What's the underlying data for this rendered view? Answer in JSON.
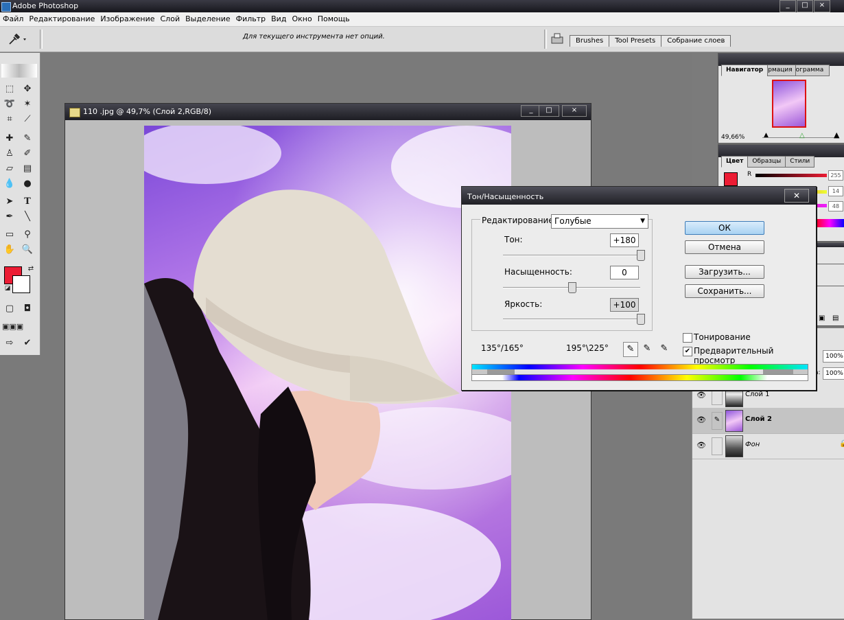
{
  "app": {
    "title": "Adobe Photoshop",
    "window_buttons": [
      "_",
      "□",
      "×"
    ]
  },
  "menu": [
    "Файл",
    "Редактирование",
    "Изображение",
    "Слой",
    "Выделение",
    "Фильтр",
    "Вид",
    "Окно",
    "Помощь"
  ],
  "options_bar": {
    "hint": "Для текущего инструмента нет опций.",
    "palette_well_tabs": [
      "Brushes",
      "Tool Presets",
      "Собрание слоев"
    ]
  },
  "toolbox": {
    "foreground_color": "#ec1c34",
    "background_color": "#ffffff",
    "tools": [
      "marquee-icon",
      "move-icon",
      "lasso-icon",
      "magic-wand-icon",
      "crop-icon",
      "slice-icon",
      "healing-icon",
      "brush-icon",
      "stamp-icon",
      "history-brush-icon",
      "eraser-icon",
      "gradient-icon",
      "blur-icon",
      "dodge-icon",
      "path-select-icon",
      "type-icon",
      "pen-icon",
      "line-icon",
      "notes-icon",
      "eyedropper-icon",
      "hand-icon",
      "zoom-icon"
    ]
  },
  "document": {
    "title": "110 .jpg @ 49,7% (Слой 2,RGB/8)",
    "buttons": [
      "_",
      "□",
      "×"
    ]
  },
  "navigator": {
    "tabs": [
      "Навигатор",
      "Информация",
      "Гистограмма"
    ],
    "visible_tab_labels": [
      "Навигатор",
      "рмация",
      "ограмма"
    ],
    "zoom": "49,66%"
  },
  "color_panel": {
    "tabs": [
      "Цвет",
      "Образцы",
      "Стили"
    ],
    "channel_label_r": "R",
    "values": [
      "255",
      "14",
      "48"
    ]
  },
  "layers": {
    "opacity_value": "100%",
    "fill_value": "100%",
    "fill_label_partial": "а:",
    "rows": [
      {
        "name": "Слой 1",
        "visible": true,
        "active": false
      },
      {
        "name": "Слой 2",
        "visible": true,
        "active": true
      },
      {
        "name": "Фон",
        "visible": true,
        "active": false
      }
    ]
  },
  "dialog": {
    "title": "Тон/Насыщенность",
    "close": "✕",
    "edit_label": "Редактирование:",
    "edit_value": "Голубые",
    "hue_label": "Тон:",
    "hue_value": "+180",
    "sat_label": "Насыщенность:",
    "sat_value": "0",
    "light_label": "Яркость:",
    "light_value": "+100",
    "hue_level": 1.0,
    "sat_level": 0.5,
    "light_level": 1.0,
    "range_left": "135°/165°",
    "range_right": "195°\\225°",
    "ok": "ОК",
    "cancel": "Отмена",
    "load": "Загрузить...",
    "save": "Сохранить...",
    "colorize_label": "Тонирование",
    "colorize_checked": false,
    "preview_label": "Предварительный просмотр",
    "preview_checked": true
  }
}
